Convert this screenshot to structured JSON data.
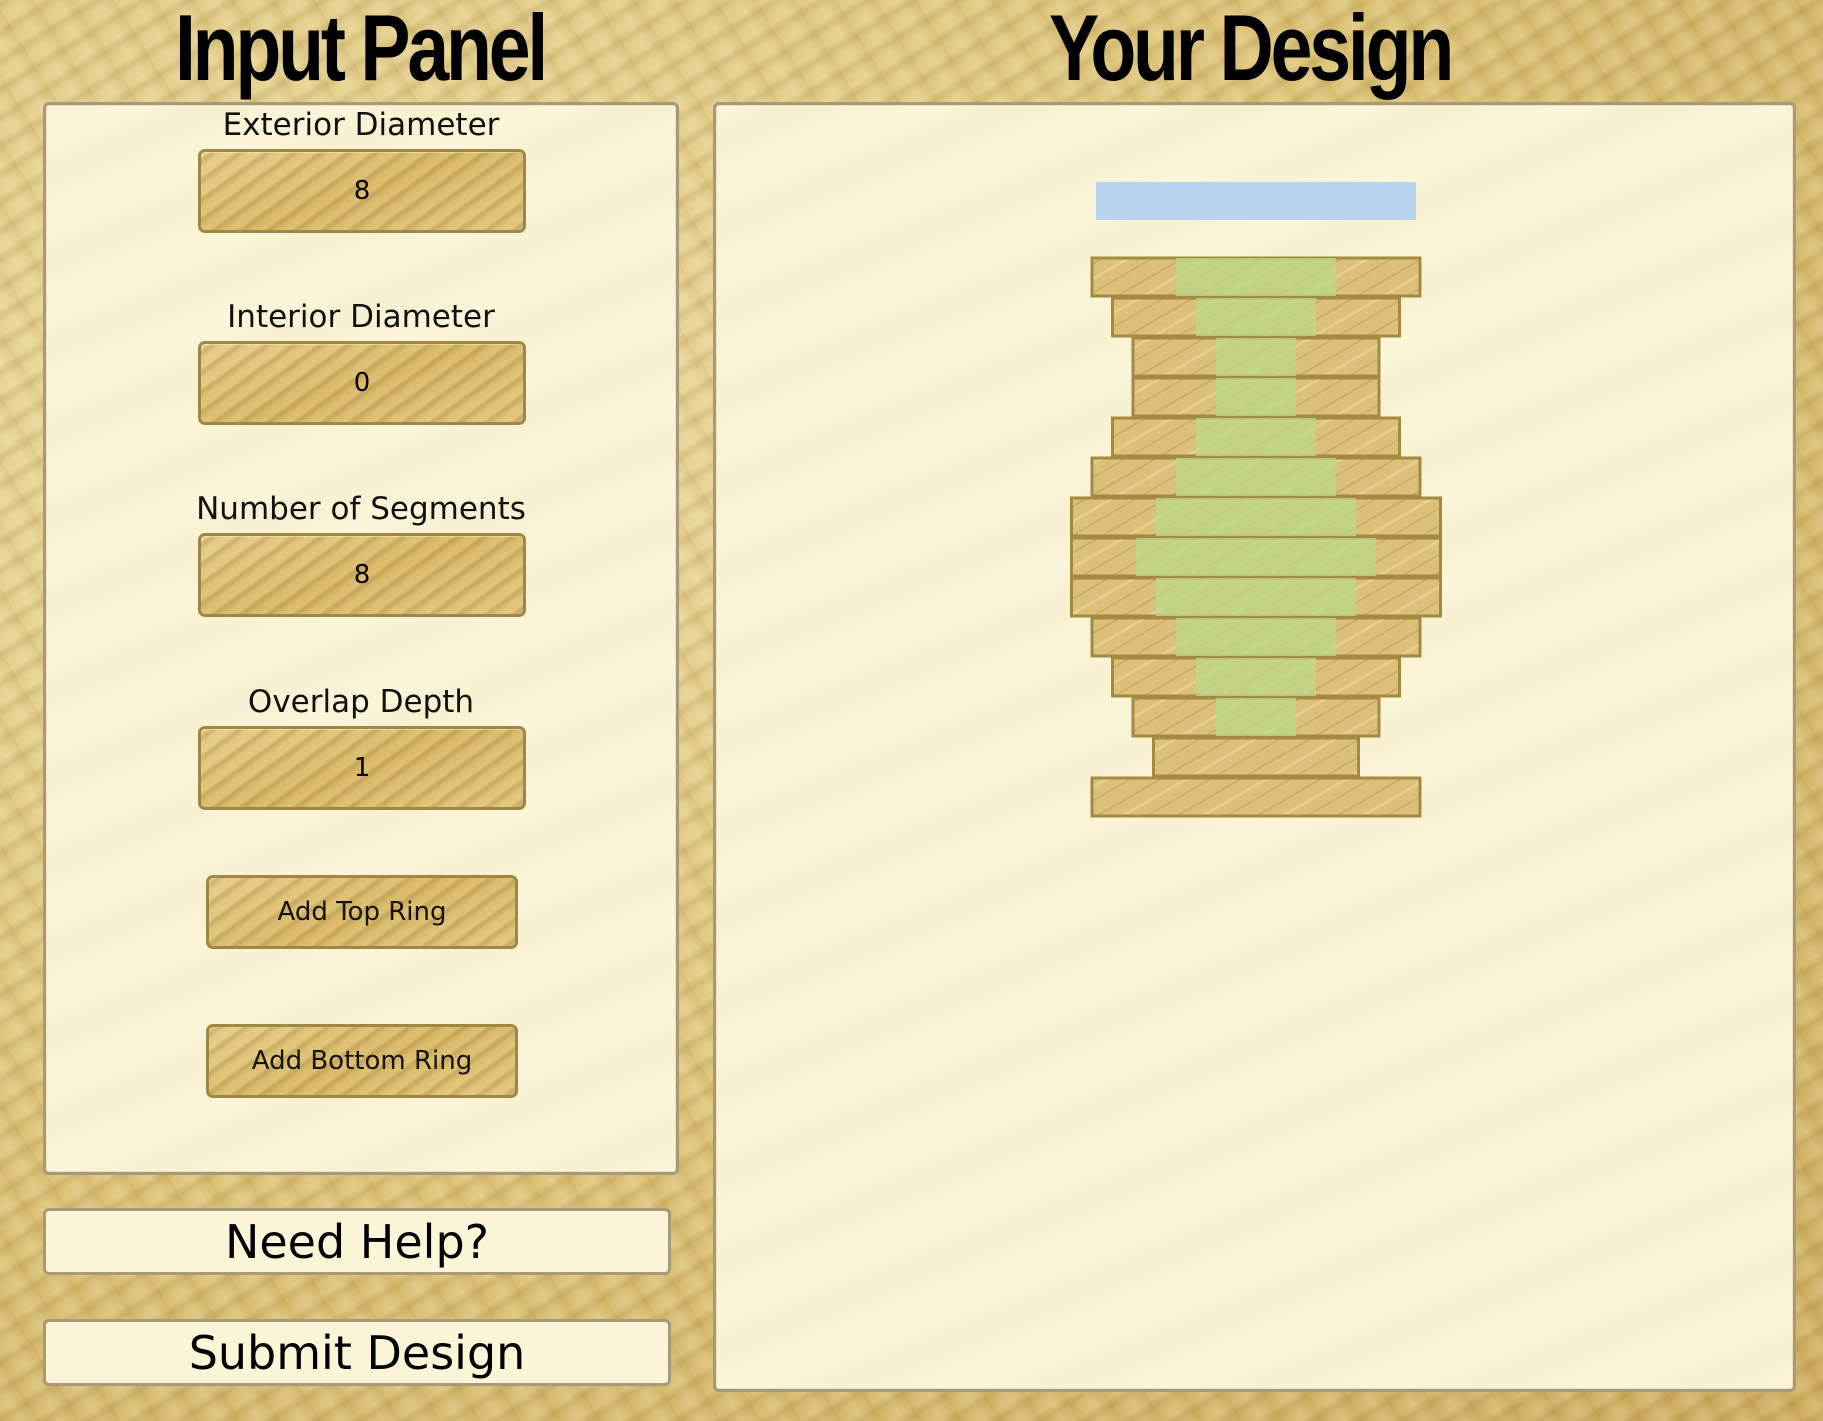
{
  "header": {
    "input_title": "Input Panel",
    "design_title": "Your Design"
  },
  "inputs": {
    "exterior_diameter": {
      "label": "Exterior Diameter",
      "value": "8"
    },
    "interior_diameter": {
      "label": "Interior Diameter",
      "value": "0"
    },
    "segments": {
      "label": "Number of Segments",
      "value": "8"
    },
    "overlap_depth": {
      "label": "Overlap Depth",
      "value": "1"
    }
  },
  "buttons": {
    "add_top_ring": "Add Top Ring",
    "add_bottom_ring": "Add Bottom Ring",
    "help": "Need Help?",
    "submit": "Submit Design"
  },
  "design": {
    "colors": {
      "wood": "#dcc07a",
      "wood_border": "#a48a40",
      "hollow": "#b9d98a",
      "preview_ring": "#b6d4ee"
    },
    "preview_ring": {
      "exterior": 8
    },
    "rings": [
      {
        "exterior": 8,
        "interior": 4
      },
      {
        "exterior": 7,
        "interior": 3
      },
      {
        "exterior": 6,
        "interior": 2
      },
      {
        "exterior": 6,
        "interior": 2
      },
      {
        "exterior": 7,
        "interior": 3
      },
      {
        "exterior": 8,
        "interior": 4
      },
      {
        "exterior": 9,
        "interior": 5
      },
      {
        "exterior": 9,
        "interior": 6
      },
      {
        "exterior": 9,
        "interior": 5
      },
      {
        "exterior": 8,
        "interior": 4
      },
      {
        "exterior": 7,
        "interior": 3
      },
      {
        "exterior": 6,
        "interior": 2
      },
      {
        "exterior": 5,
        "interior": 0
      },
      {
        "exterior": 8,
        "interior": 0
      }
    ]
  }
}
